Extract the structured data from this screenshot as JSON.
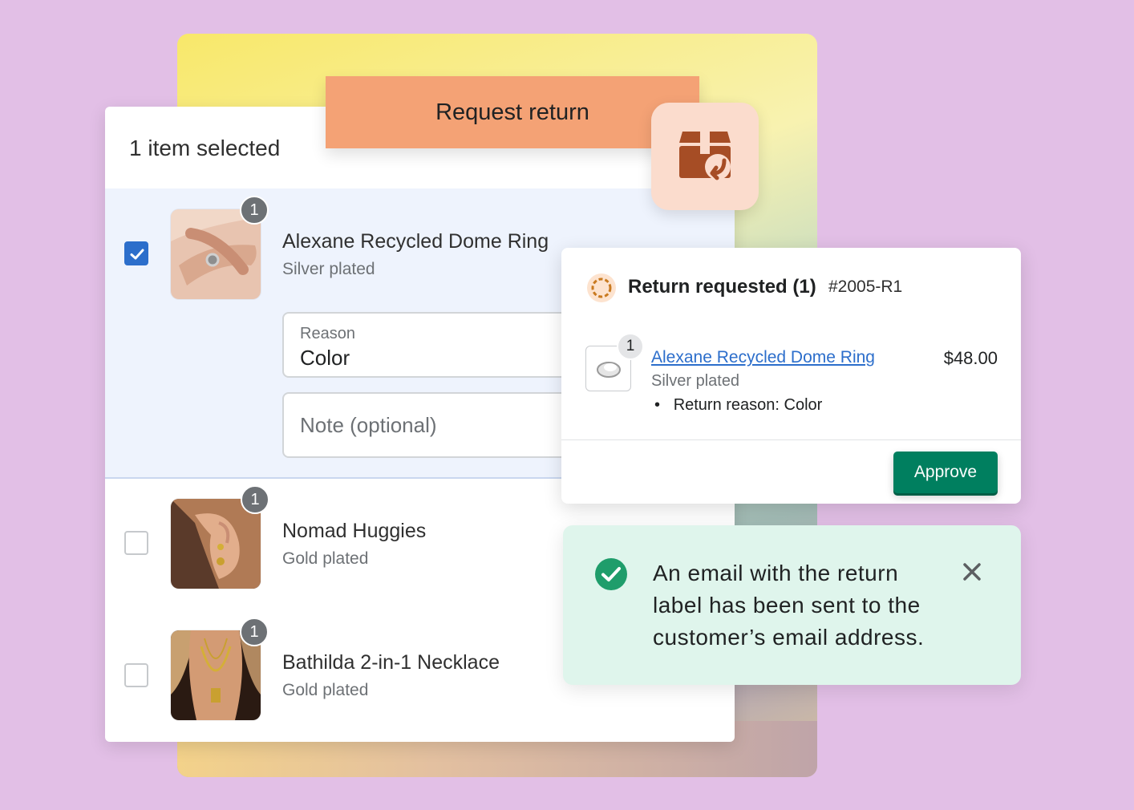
{
  "request_return": {
    "label": "Request return",
    "icon": "package-return-icon"
  },
  "selection": {
    "count_label": "1 item selected"
  },
  "items": [
    {
      "name": "Alexane Recycled Dome Ring",
      "variant": "Silver plated",
      "quantity": "1",
      "checked": true
    },
    {
      "name": "Nomad Huggies",
      "variant": "Gold plated",
      "quantity": "1",
      "checked": false
    },
    {
      "name": "Bathilda 2-in-1 Necklace",
      "variant": "Gold plated",
      "quantity": "1",
      "checked": false
    }
  ],
  "form": {
    "reason_label": "Reason",
    "reason_value": "Color",
    "note_placeholder": "Note (optional)"
  },
  "return_card": {
    "title": "Return requested (1)",
    "number": "#2005-R1",
    "product_name": "Alexane Recycled Dome Ring",
    "variant": "Silver plated",
    "quantity": "1",
    "price": "$48.00",
    "reason_bullet": "•",
    "reason": "Return reason: Color",
    "approve_label": "Approve"
  },
  "toast": {
    "message": "An email with the return label has been sent to the customer’s email address."
  },
  "colors": {
    "background": "#e2bfe6",
    "request_button": "#f4a275",
    "approve_button": "#007f5f",
    "checkbox_checked": "#2c6ecb",
    "toast_background": "#dff5ec",
    "success": "#1f9d6b",
    "icon_brown": "#a64d25"
  }
}
